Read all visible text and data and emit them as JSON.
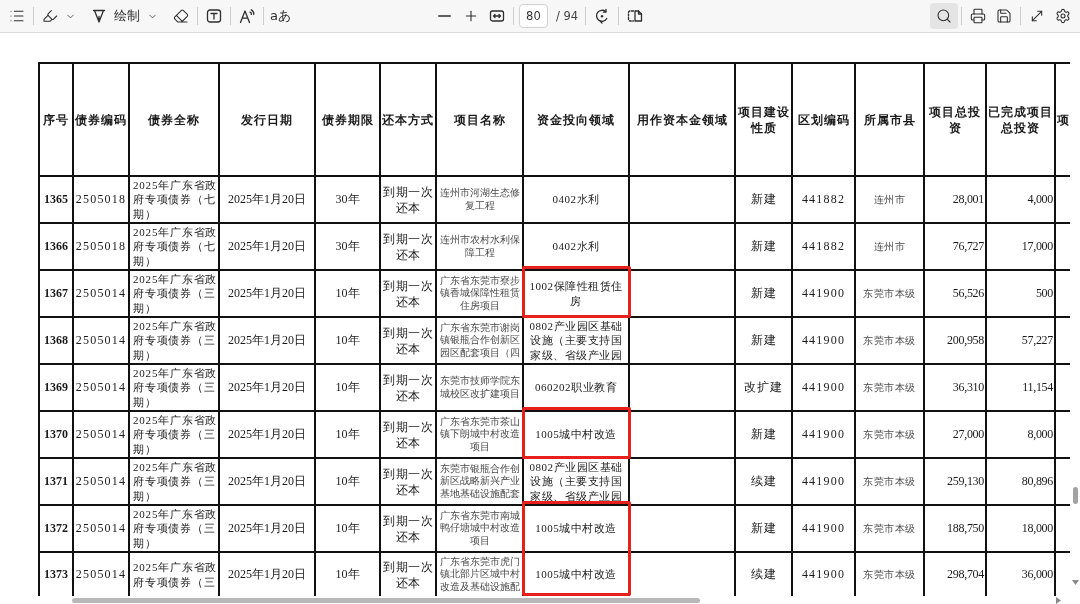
{
  "toolbar": {
    "left": [
      [
        {
          "kind": "contents"
        }
      ],
      [
        {
          "kind": "highlight",
          "dropdown": true
        },
        {
          "kind": "draw",
          "label": "绘制",
          "dropdown": true
        },
        {
          "kind": "eraser"
        }
      ],
      [
        {
          "kind": "textbox"
        }
      ],
      [
        {
          "kind": "read"
        }
      ],
      [
        {
          "kind": "glyph",
          "label": "aあ"
        }
      ]
    ],
    "center": [
      [
        {
          "kind": "zoomout"
        },
        {
          "kind": "zoomin"
        },
        {
          "kind": "fit"
        }
      ],
      [
        {
          "kind": "page",
          "value": "80",
          "total": "/ 94"
        }
      ],
      [
        {
          "kind": "rotate"
        }
      ],
      [
        {
          "kind": "layout"
        }
      ]
    ],
    "right": [
      [
        {
          "kind": "search",
          "active": true
        }
      ],
      [
        {
          "kind": "print"
        },
        {
          "kind": "save"
        }
      ],
      [
        {
          "kind": "fullscreen"
        },
        {
          "kind": "settings"
        }
      ]
    ]
  },
  "table": {
    "columns": [
      "序号",
      "债券编码",
      "债券全称",
      "发行日期",
      "债券期限",
      "还本方式",
      "项目名称",
      "资金投向领域",
      "用作资本金领域",
      "项目建设性质",
      "区划编码",
      "所属市县",
      "项目总投资",
      "已完成项目总投资",
      "项"
    ],
    "rows": [
      {
        "seq": "1365",
        "bond_code": "2505018",
        "bond_name": "2025年广东省政府专项债券（七期）",
        "issue_date": "2025年1月20日",
        "term": "30年",
        "repayment": "到期一次还本",
        "project_name": "连州市河湖生态修复工程",
        "fund_area": "0402水利",
        "construction_type": "新建",
        "region_code": "441882",
        "city": "连州市",
        "total_investment": "28,001",
        "completed_investment": "4,000",
        "highlight": false
      },
      {
        "seq": "1366",
        "bond_code": "2505018",
        "bond_name": "2025年广东省政府专项债券（七期）",
        "issue_date": "2025年1月20日",
        "term": "30年",
        "repayment": "到期一次还本",
        "project_name": "连州市农村水利保障工程",
        "fund_area": "0402水利",
        "construction_type": "新建",
        "region_code": "441882",
        "city": "连州市",
        "total_investment": "76,727",
        "completed_investment": "17,000",
        "highlight": false
      },
      {
        "seq": "1367",
        "bond_code": "2505014",
        "bond_name": "2025年广东省政府专项债券（三期）",
        "issue_date": "2025年1月20日",
        "term": "10年",
        "repayment": "到期一次还本",
        "project_name": "广东省东莞市寮步镇香城保障性租赁住房项目",
        "fund_area": "1002保障性租赁住房",
        "construction_type": "新建",
        "region_code": "441900",
        "city": "东莞市本级",
        "total_investment": "56,526",
        "completed_investment": "500",
        "highlight": true
      },
      {
        "seq": "1368",
        "bond_code": "2505014",
        "bond_name": "2025年广东省政府专项债券（三期）",
        "issue_date": "2025年1月20日",
        "term": "10年",
        "repayment": "到期一次还本",
        "project_name": "广东省东莞市谢岗镇银瓶合作创新区园区配套项目（四",
        "fund_area": "0802产业园区基础设施（主要支持国家级、省级产业园",
        "construction_type": "新建",
        "region_code": "441900",
        "city": "东莞市本级",
        "total_investment": "200,958",
        "completed_investment": "57,227",
        "highlight": false
      },
      {
        "seq": "1369",
        "bond_code": "2505014",
        "bond_name": "2025年广东省政府专项债券（三期）",
        "issue_date": "2025年1月20日",
        "term": "10年",
        "repayment": "到期一次还本",
        "project_name": "东莞市技师学院东城校区改扩建项目",
        "fund_area": "060202职业教育",
        "construction_type": "改扩建",
        "region_code": "441900",
        "city": "东莞市本级",
        "total_investment": "36,310",
        "completed_investment": "11,154",
        "highlight": false
      },
      {
        "seq": "1370",
        "bond_code": "2505014",
        "bond_name": "2025年广东省政府专项债券（三期）",
        "issue_date": "2025年1月20日",
        "term": "10年",
        "repayment": "到期一次还本",
        "project_name": "广东省东莞市茶山镇下朗城中村改造项目",
        "fund_area": "1005城中村改造",
        "construction_type": "新建",
        "region_code": "441900",
        "city": "东莞市本级",
        "total_investment": "27,000",
        "completed_investment": "8,000",
        "highlight": true
      },
      {
        "seq": "1371",
        "bond_code": "2505014",
        "bond_name": "2025年广东省政府专项债券（三期）",
        "issue_date": "2025年1月20日",
        "term": "10年",
        "repayment": "到期一次还本",
        "project_name": "东莞市银瓶合作创新区战略新兴产业基地基础设施配套",
        "fund_area": "0802产业园区基础设施（主要支持国家级、省级产业园",
        "construction_type": "续建",
        "region_code": "441900",
        "city": "东莞市本级",
        "total_investment": "259,130",
        "completed_investment": "80,896",
        "highlight": false
      },
      {
        "seq": "1372",
        "bond_code": "2505014",
        "bond_name": "2025年广东省政府专项债券（三期）",
        "issue_date": "2025年1月20日",
        "term": "10年",
        "repayment": "到期一次还本",
        "project_name": "广东省东莞市南城鸭仔塘城中村改造项目",
        "fund_area": "1005城中村改造",
        "construction_type": "新建",
        "region_code": "441900",
        "city": "东莞市本级",
        "total_investment": "188,750",
        "completed_investment": "18,000",
        "highlight": true
      },
      {
        "seq": "1373",
        "bond_code": "2505014",
        "bond_name": "2025年广东省政府专项债券（三",
        "issue_date": "2025年1月20日",
        "term": "10年",
        "repayment": "到期一次还本",
        "project_name": "广东省东莞市虎门镇北部片区城中村改造及基础设施配",
        "fund_area": "1005城中村改造",
        "construction_type": "续建",
        "region_code": "441900",
        "city": "东莞市本级",
        "total_investment": "298,704",
        "completed_investment": "36,000",
        "highlight": true
      }
    ]
  }
}
